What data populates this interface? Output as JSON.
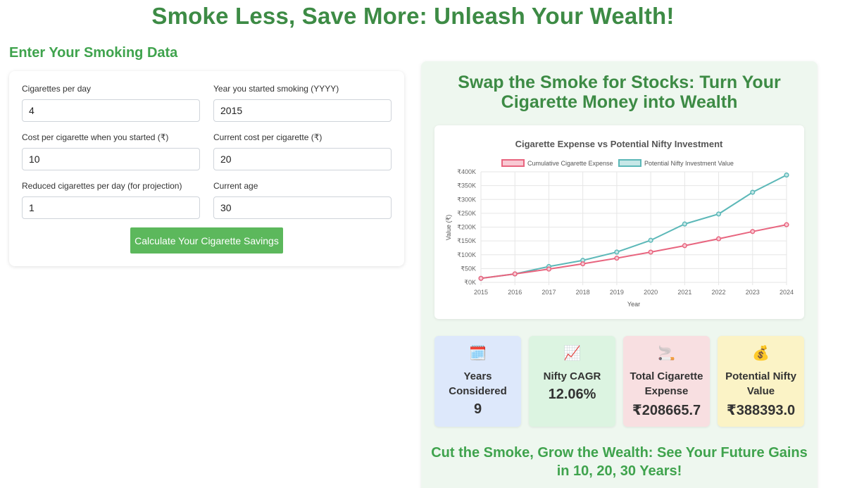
{
  "header": {
    "title": "Smoke Less, Save More: Unleash Your Wealth!"
  },
  "form": {
    "section_title": "Enter Your Smoking Data",
    "fields": {
      "cigarettes_per_day": {
        "label": "Cigarettes per day",
        "value": "4"
      },
      "year_started": {
        "label": "Year you started smoking (YYYY)",
        "value": "2015"
      },
      "cost_when_started": {
        "label": "Cost per cigarette when you started (₹)",
        "value": "10"
      },
      "current_cost": {
        "label": "Current cost per cigarette (₹)",
        "value": "20"
      },
      "reduced_cigarettes": {
        "label": "Reduced cigarettes per day (for projection)",
        "value": "1"
      },
      "current_age": {
        "label": "Current age",
        "value": "30"
      }
    },
    "calculate_label": "Calculate Your Cigarette Savings"
  },
  "results": {
    "title": "Swap the Smoke for Stocks: Turn Your Cigarette Money into Wealth",
    "stats": [
      {
        "icon": "🗓️",
        "icon_name": "calendar-icon",
        "label": "Years Considered",
        "value": "9",
        "bg": "#dde8fb"
      },
      {
        "icon": "📈",
        "icon_name": "chart-increasing-icon",
        "label": "Nifty CAGR",
        "value": "12.06%",
        "bg": "#dcf4e1"
      },
      {
        "icon": "🚬",
        "icon_name": "cigarette-icon",
        "label": "Total Cigarette Expense",
        "value": "₹208665.7",
        "bg": "#f8dfe1"
      },
      {
        "icon": "💰",
        "icon_name": "money-bag-icon",
        "label": "Potential Nifty Value",
        "value": "₹388393.0",
        "bg": "#fbf3c6"
      }
    ],
    "future_title": "Cut the Smoke, Grow the Wealth: See Your Future Gains in 10, 20, 30 Years!"
  },
  "chart_data": {
    "type": "line",
    "title": "Cigarette Expense vs Potential Nifty Investment",
    "xlabel": "Year",
    "ylabel": "Value (₹)",
    "ylim": [
      0,
      400000
    ],
    "y_ticks": [
      "₹0K",
      "₹50K",
      "₹100K",
      "₹150K",
      "₹200K",
      "₹250K",
      "₹300K",
      "₹350K",
      "₹400K"
    ],
    "grid": true,
    "legend_position": "top",
    "x": [
      "2015",
      "2016",
      "2017",
      "2018",
      "2019",
      "2020",
      "2021",
      "2022",
      "2023",
      "2024"
    ],
    "series": [
      {
        "name": "Cumulative Cigarette Expense",
        "color": "#e8657f",
        "fill": "#f8c9d3",
        "values": [
          14600,
          30660,
          48180,
          67160,
          87600,
          109500,
          132860,
          157680,
          183960,
          208666
        ]
      },
      {
        "name": "Potential Nifty Investment Value",
        "color": "#5cb8b8",
        "fill": "#c6e7e7",
        "values": [
          14600,
          30600,
          57400,
          79700,
          109700,
          152300,
          211200,
          247400,
          326000,
          388393
        ]
      }
    ]
  }
}
